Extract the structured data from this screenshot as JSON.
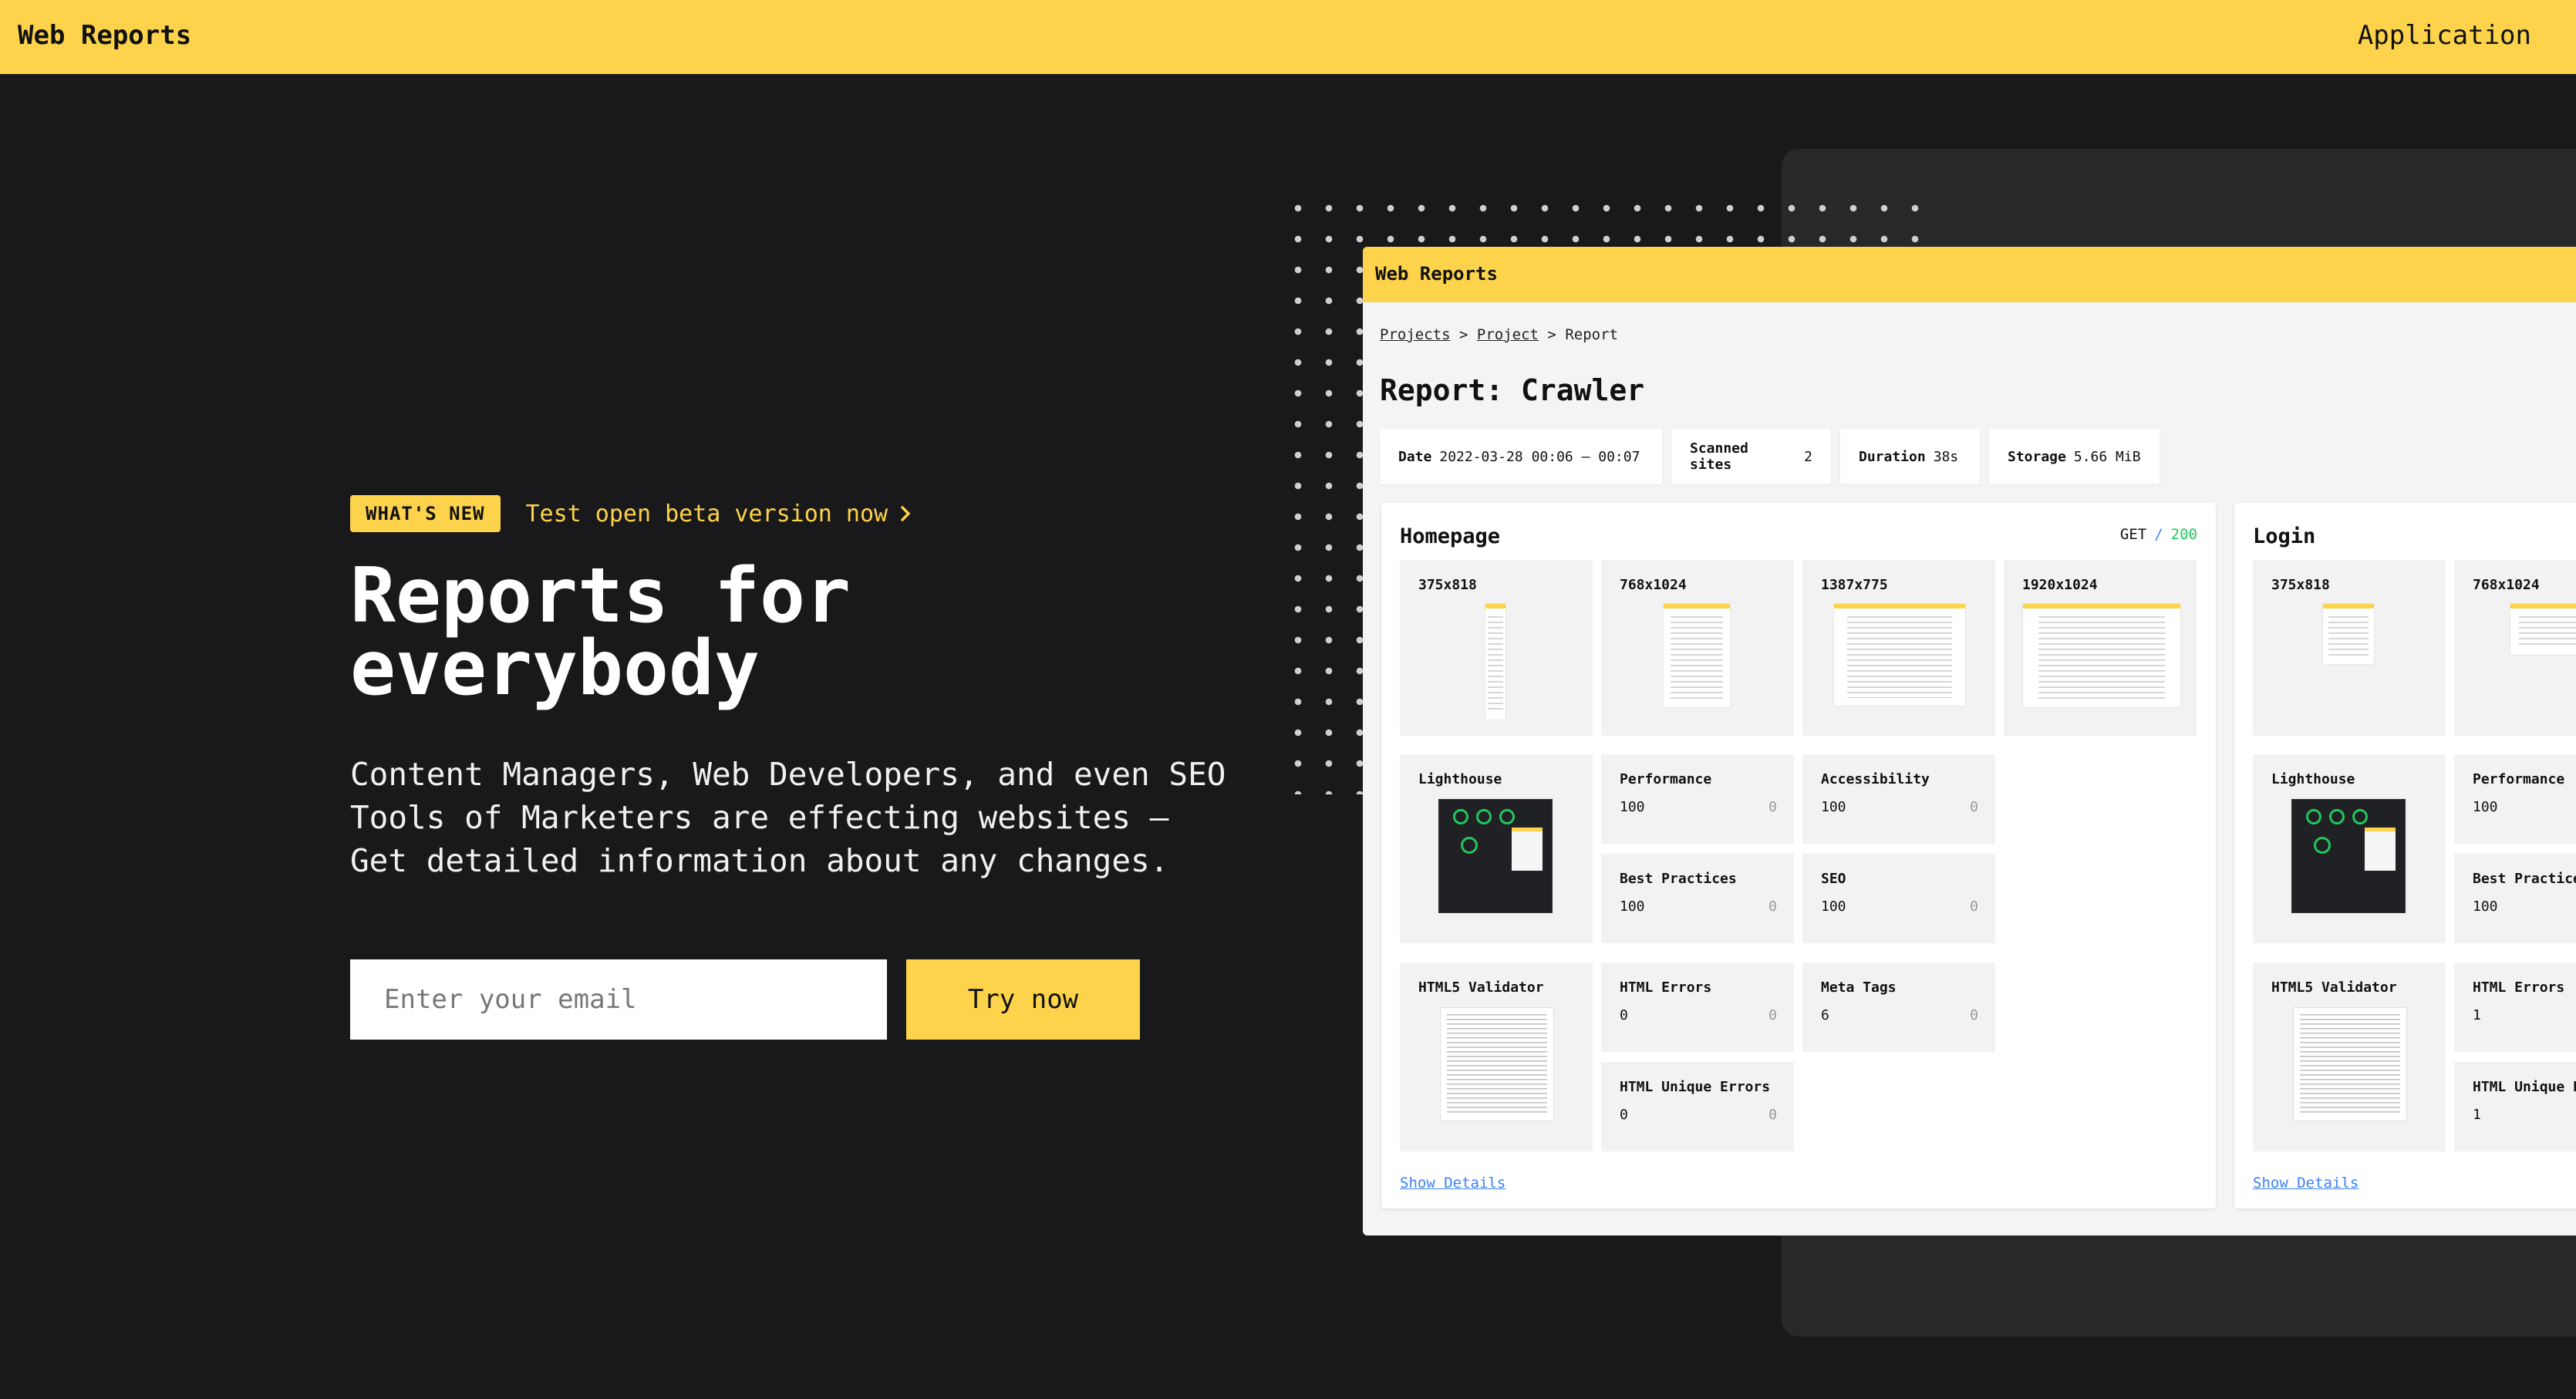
{
  "nav": {
    "brand": "Web Reports",
    "app_link": "Application"
  },
  "hero": {
    "badge": "WHAT'S NEW",
    "beta_link": "Test open beta version now",
    "headline_line1": "Reports for",
    "headline_line2": "everybody",
    "subtext_line1": "Content Managers, Web Developers, and even SEO",
    "subtext_line2": "Tools of Marketers are effecting websites –",
    "subtext_line3": "Get detailed information about any changes.",
    "email_placeholder": "Enter your email",
    "cta_label": "Try now"
  },
  "preview": {
    "brand": "Web Reports",
    "breadcrumb": {
      "projects": "Projects",
      "sep1": ">",
      "project": "Project",
      "sep2": ">",
      "report": "Report"
    },
    "title": "Report: Crawler",
    "stats": [
      {
        "label": "Date",
        "value": "2022-03-28 00:06 – 00:07"
      },
      {
        "label": "Scanned sites",
        "value": "2"
      },
      {
        "label": "Duration",
        "value": "38s"
      },
      {
        "label": "Storage",
        "value": "5.66 MiB"
      }
    ],
    "pages": [
      {
        "name": "Homepage",
        "method": "GET",
        "status": "200",
        "screenshots": [
          "375x818",
          "768x1024",
          "1387x775",
          "1920x1024"
        ],
        "lighthouse_label": "Lighthouse",
        "metrics": [
          {
            "label": "Performance",
            "value": "100",
            "diff": "0"
          },
          {
            "label": "Accessibility",
            "value": "100",
            "diff": "0"
          },
          {
            "label": "Best Practices",
            "value": "100",
            "diff": "0"
          },
          {
            "label": "SEO",
            "value": "100",
            "diff": "0"
          }
        ],
        "validator_label": "HTML5 Validator",
        "validator_metrics": [
          {
            "label": "HTML Errors",
            "value": "0",
            "diff": "0"
          },
          {
            "label": "Meta Tags",
            "value": "6",
            "diff": "0"
          },
          {
            "label": "HTML Unique Errors",
            "value": "0",
            "diff": "0"
          }
        ],
        "details_link": "Show Details"
      },
      {
        "name": "Login",
        "screenshots": [
          "375x818",
          "768x1024"
        ],
        "lighthouse_label": "Lighthouse",
        "metrics": [
          {
            "label": "Performance",
            "value": "100"
          },
          {
            "label": "Best Practice",
            "value": "100"
          }
        ],
        "validator_label": "HTML5 Validator",
        "validator_metrics": [
          {
            "label": "HTML Errors",
            "value": "1"
          },
          {
            "label": "HTML Unique E",
            "value": "1"
          }
        ],
        "details_link": "Show Details"
      }
    ]
  },
  "colors": {
    "accent": "#fdd34b",
    "background": "#19191b",
    "link": "#3b82f6",
    "success": "#22c55e"
  }
}
